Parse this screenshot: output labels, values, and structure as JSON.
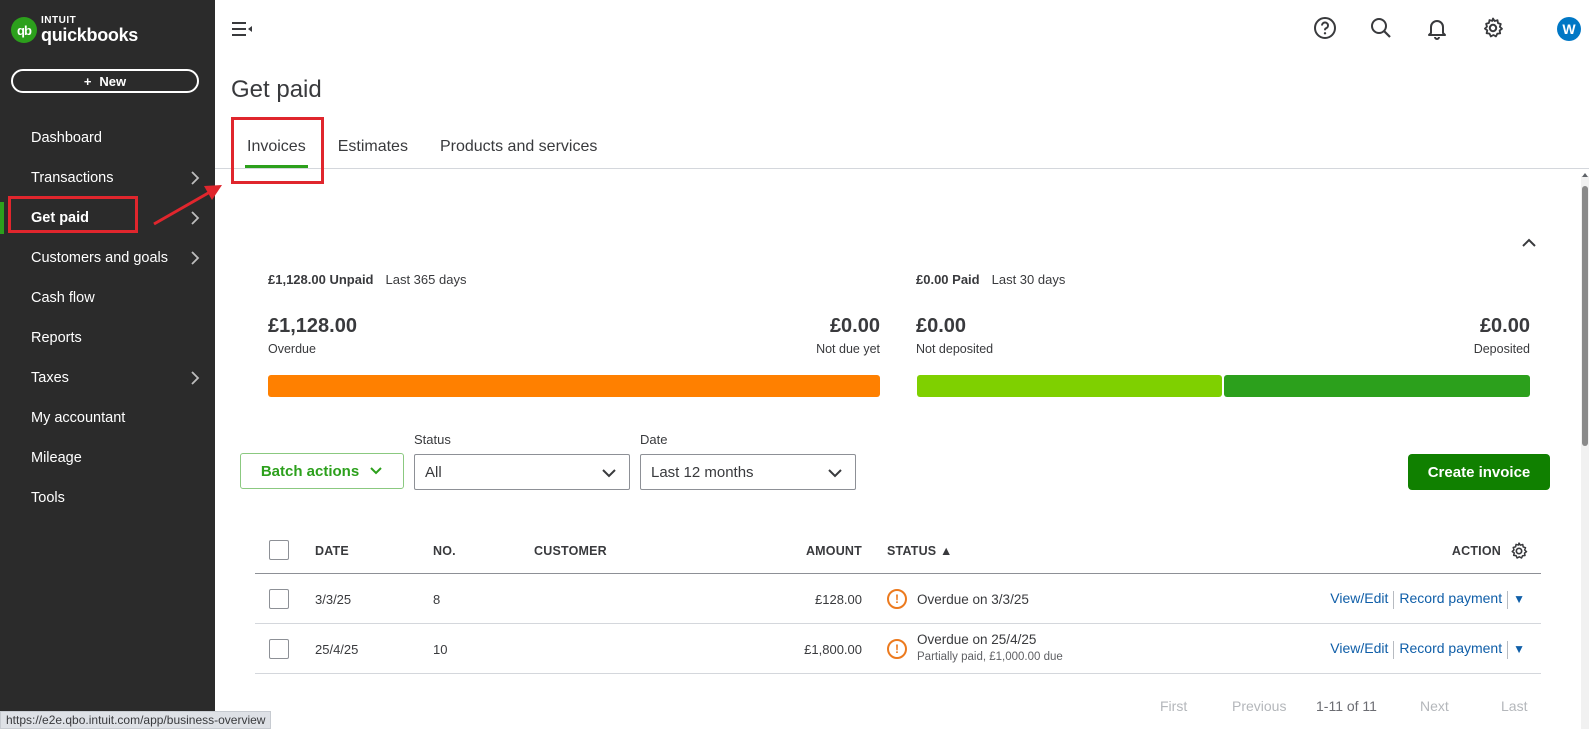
{
  "brand": {
    "intuit": "INTUIT",
    "product": "quickbooks",
    "badge": "qb"
  },
  "sidebar": {
    "new_label": "New",
    "items": [
      {
        "label": "Dashboard",
        "has_chevron": false
      },
      {
        "label": "Transactions",
        "has_chevron": true
      },
      {
        "label": "Get paid",
        "has_chevron": true,
        "active": true
      },
      {
        "label": "Customers and goals",
        "has_chevron": true
      },
      {
        "label": "Cash flow",
        "has_chevron": false
      },
      {
        "label": "Reports",
        "has_chevron": false
      },
      {
        "label": "Taxes",
        "has_chevron": true
      },
      {
        "label": "My accountant",
        "has_chevron": false
      },
      {
        "label": "Mileage",
        "has_chevron": false
      },
      {
        "label": "Tools",
        "has_chevron": false
      }
    ]
  },
  "header": {
    "avatar_initial": "W",
    "icons": [
      "help-icon",
      "search-icon",
      "bell-icon",
      "gear-icon"
    ]
  },
  "page": {
    "title": "Get paid"
  },
  "tabs": [
    {
      "label": "Invoices",
      "selected": true
    },
    {
      "label": "Estimates",
      "selected": false
    },
    {
      "label": "Products and services",
      "selected": false
    }
  ],
  "summary": {
    "unpaid": {
      "heading": "£1,128.00 Unpaid",
      "range": "Last 365 days",
      "overdue_amount": "£1,128.00",
      "overdue_label": "Overdue",
      "notdue_amount": "£0.00",
      "notdue_label": "Not due yet",
      "bar_color": "#ff8000"
    },
    "paid": {
      "heading": "£0.00 Paid",
      "range": "Last 30 days",
      "notdeposited_amount": "£0.00",
      "notdeposited_label": "Not deposited",
      "deposited_amount": "£0.00",
      "deposited_label": "Deposited",
      "bar_color_left": "#7fd000",
      "bar_color_right": "#2ca01c"
    }
  },
  "filters": {
    "batch_label": "Batch actions",
    "status_label": "Status",
    "status_value": "All",
    "date_label": "Date",
    "date_value": "Last 12 months",
    "create_label": "Create invoice"
  },
  "table": {
    "headers": {
      "date": "DATE",
      "no": "NO.",
      "customer": "CUSTOMER",
      "amount": "AMOUNT",
      "status": "STATUS ▲",
      "action": "ACTION"
    },
    "rows": [
      {
        "date": "3/3/25",
        "no": "8",
        "customer": "",
        "amount": "£128.00",
        "status": "Overdue on 3/3/25",
        "status_sub": "",
        "view": "View/Edit",
        "record": "Record payment"
      },
      {
        "date": "25/4/25",
        "no": "10",
        "customer": "",
        "amount": "£1,800.00",
        "status": "Overdue on 25/4/25",
        "status_sub": "Partially paid, £1,000.00 due",
        "view": "View/Edit",
        "record": "Record payment"
      }
    ]
  },
  "pager": {
    "first": "First",
    "previous": "Previous",
    "count": "1-11 of 11",
    "next": "Next",
    "last": "Last"
  },
  "url_status": "https://e2e.qbo.intuit.com/app/business-overview",
  "colors": {
    "brand_green": "#2ca01c",
    "create_green": "#108000",
    "link_blue": "#0f5ea8",
    "highlight_red": "#e0262d",
    "overdue_orange": "#ec7a1e"
  }
}
